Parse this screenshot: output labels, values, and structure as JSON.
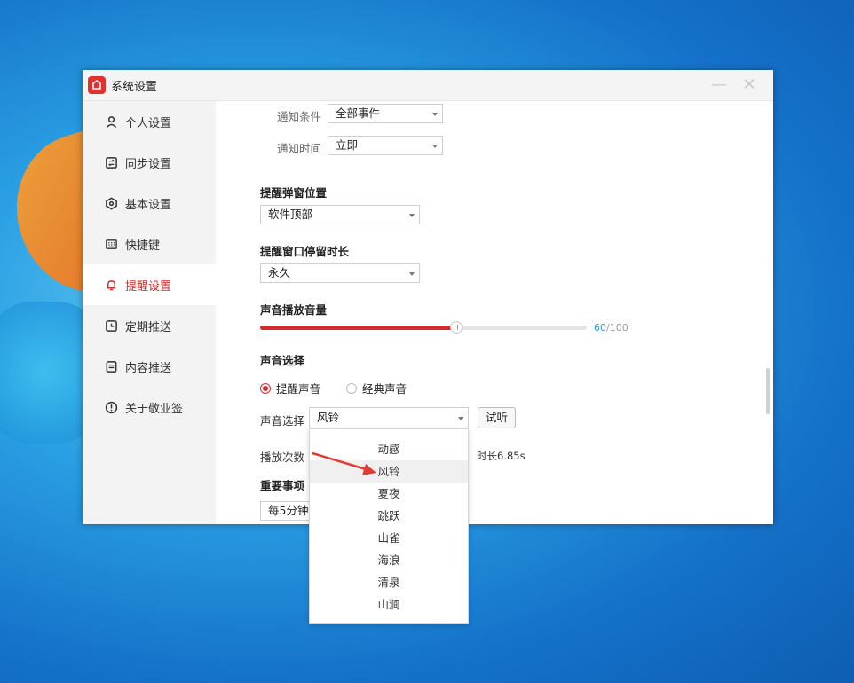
{
  "window": {
    "title": "系统设置",
    "minimize_symbol": "—",
    "close_symbol": "✕",
    "logo_icon": "cloud-logo-icon"
  },
  "sidebar": {
    "items": [
      {
        "label": "个人设置",
        "icon": "person-icon"
      },
      {
        "label": "同步设置",
        "icon": "sync-icon"
      },
      {
        "label": "基本设置",
        "icon": "settings-icon"
      },
      {
        "label": "快捷键",
        "icon": "keyboard-icon"
      },
      {
        "label": "提醒设置",
        "icon": "bell-icon",
        "active": true
      },
      {
        "label": "定期推送",
        "icon": "calendar-icon"
      },
      {
        "label": "内容推送",
        "icon": "document-icon"
      },
      {
        "label": "关于敬业签",
        "icon": "info-icon"
      }
    ]
  },
  "settings": {
    "notify_condition": {
      "label": "通知条件",
      "value": "全部事件"
    },
    "notify_time": {
      "label": "通知时间",
      "value": "立即"
    },
    "popup_position": {
      "title": "提醒弹窗位置",
      "value": "软件顶部"
    },
    "popup_duration": {
      "title": "提醒窗口停留时长",
      "value": "永久"
    },
    "volume": {
      "title": "声音播放音量",
      "value": 60,
      "max": 100,
      "value_text": "60",
      "max_text": "/100"
    },
    "sound_choice": {
      "title": "声音选择",
      "radio_reminder": "提醒声音",
      "radio_classic": "经典声音",
      "select_label": "声音选择",
      "select_value": "风铃",
      "preview_button": "试听"
    },
    "play_count": {
      "label": "播放次数",
      "duration_text": "时长6.85s"
    },
    "important": {
      "title": "重要事项",
      "value": "每5分钟"
    }
  },
  "dropdown": {
    "options": [
      "动感",
      "风铃",
      "夏夜",
      "跳跃",
      "山雀",
      "海浪",
      "清泉",
      "山涧"
    ],
    "highlighted": "风铃"
  },
  "colors": {
    "accent": "#d42b2b",
    "volume_value": "#2a9fd8"
  }
}
